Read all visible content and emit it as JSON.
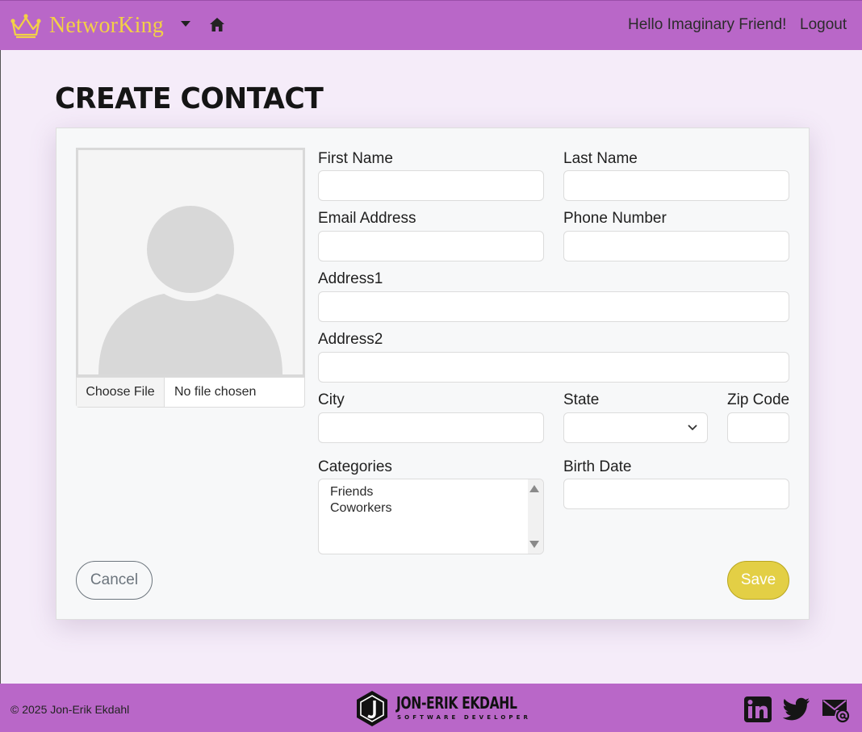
{
  "navbar": {
    "brand": "NetworKing",
    "greeting": "Hello Imaginary Friend!",
    "logout": "Logout",
    "icons": [
      "crown-icon",
      "caret-down-icon",
      "home-icon"
    ]
  },
  "page": {
    "title": "CREATE CONTACT"
  },
  "form": {
    "file": {
      "button": "Choose File",
      "status": "No file chosen"
    },
    "labels": {
      "first_name": "First Name",
      "last_name": "Last Name",
      "email": "Email Address",
      "phone": "Phone Number",
      "address1": "Address1",
      "address2": "Address2",
      "city": "City",
      "state": "State",
      "zip": "Zip Code",
      "categories": "Categories",
      "birth_date": "Birth Date"
    },
    "values": {
      "first_name": "",
      "last_name": "",
      "email": "",
      "phone": "",
      "address1": "",
      "address2": "",
      "city": "",
      "state": "",
      "zip": "",
      "birth_date": ""
    },
    "categories": [
      "Friends",
      "Coworkers"
    ],
    "cancel": "Cancel",
    "save": "Save"
  },
  "footer": {
    "copyright": "© 2025 Jon-Erik Ekdahl",
    "logo_name": "JON-ERIK EKDAHL",
    "logo_sub": "SOFTWARE DEVELOPER",
    "icons": [
      "linkedin-icon",
      "twitter-icon",
      "mail-icon"
    ]
  },
  "colors": {
    "nav_bg": "#b967c8",
    "brand": "#f3d046",
    "page_bg": "#f5ecf9",
    "save": "#e3cf45",
    "cancel": "#6c757d"
  }
}
